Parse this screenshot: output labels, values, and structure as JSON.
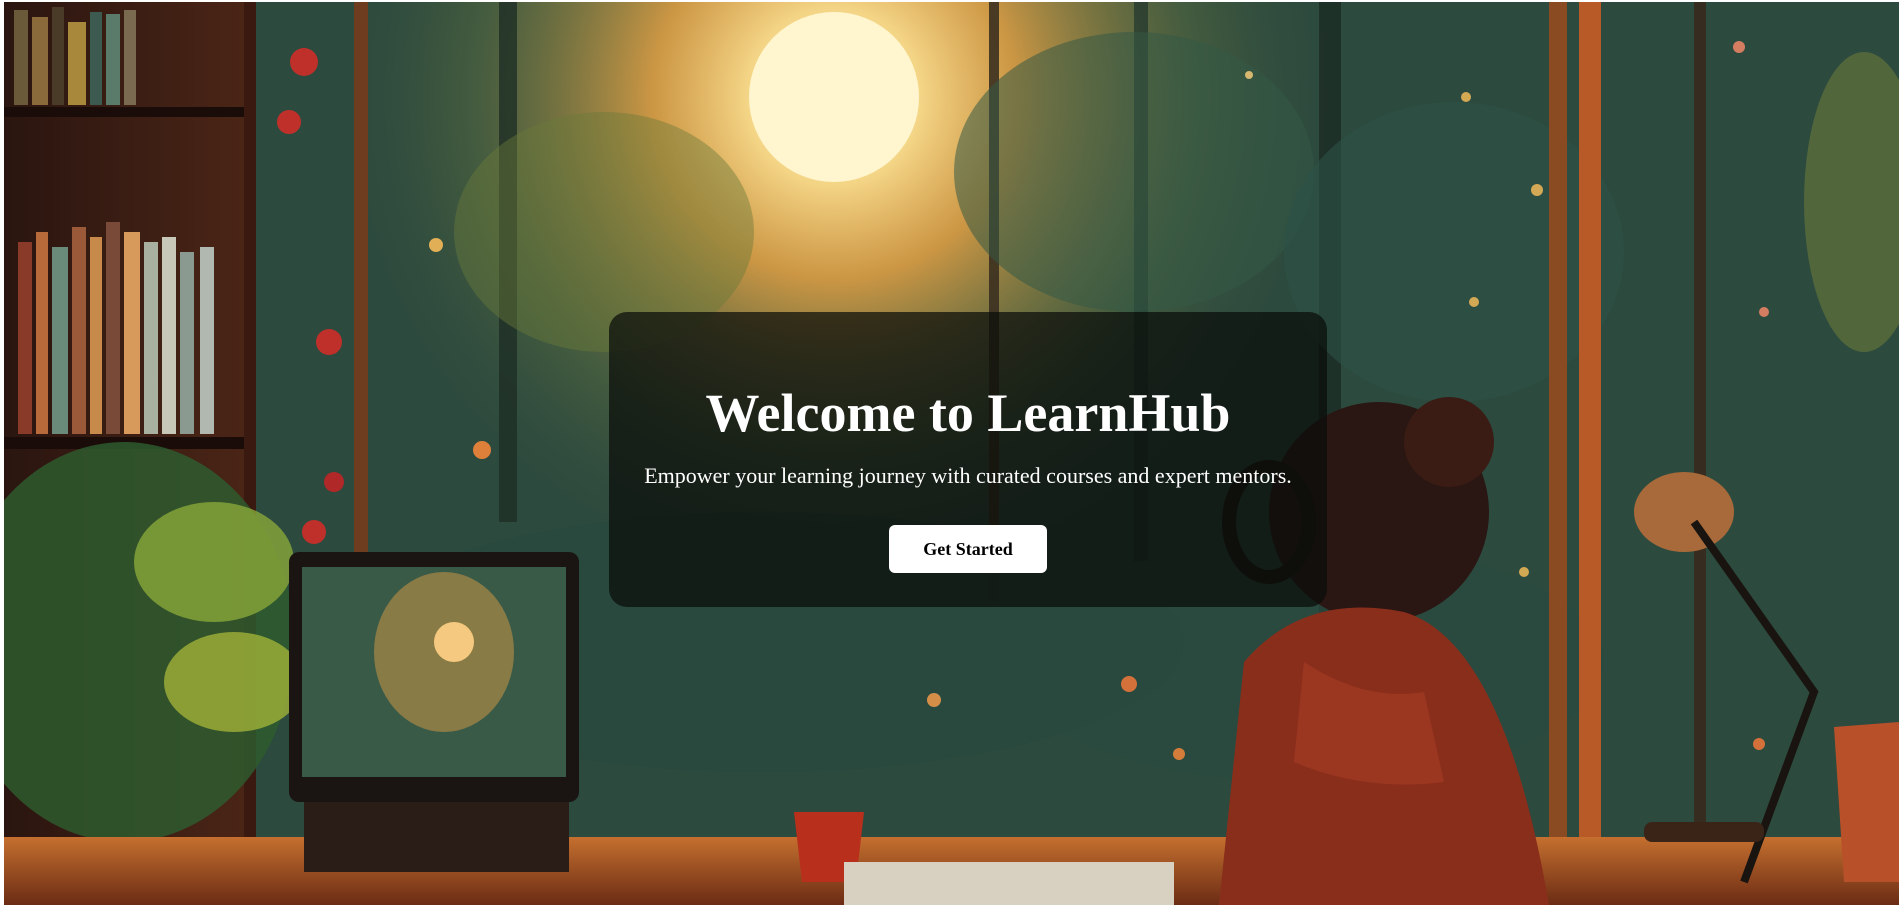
{
  "hero": {
    "title": "Welcome to LearnHub",
    "subtitle": "Empower your learning journey with curated courses and expert mentors.",
    "cta_label": "Get Started",
    "background_image": "lofi-study-room-illustration"
  },
  "colors": {
    "card_overlay": "#0a0c0a",
    "text": "#ffffff",
    "button_bg": "#ffffff",
    "button_text": "#000000"
  }
}
